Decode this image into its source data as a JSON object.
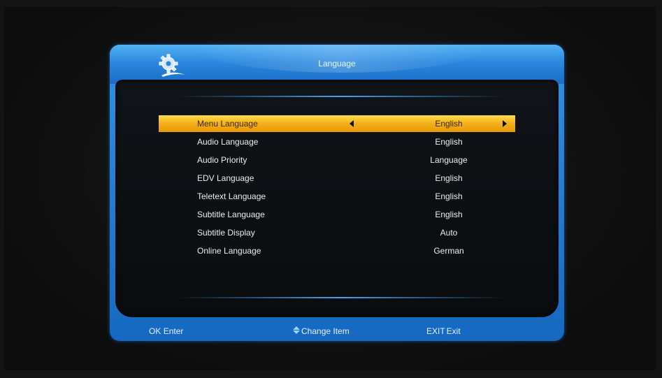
{
  "window": {
    "title": "Language"
  },
  "menu": {
    "items": [
      {
        "label": "Menu Language",
        "value": "English",
        "selected": true
      },
      {
        "label": "Audio Language",
        "value": "English"
      },
      {
        "label": "Audio Priority",
        "value": "Language"
      },
      {
        "label": "EDV Language",
        "value": "English"
      },
      {
        "label": "Teletext Language",
        "value": "English"
      },
      {
        "label": "Subtitle Language",
        "value": "English"
      },
      {
        "label": "Subtitle Display",
        "value": "Auto"
      },
      {
        "label": "Online Language",
        "value": "German"
      }
    ]
  },
  "footer": {
    "ok_key": "OK",
    "ok_label": "Enter",
    "change_label": "Change Item",
    "exit_key": "EXIT",
    "exit_label": "Exit"
  },
  "icons": {
    "logo": "gear-wrench-icon",
    "left_arrow": "triangle-left-icon",
    "right_arrow": "triangle-right-icon",
    "updown": "up-down-arrows-icon"
  },
  "colors": {
    "selection": "#f1ac16",
    "frame": "#1f78d0",
    "content_bg": "#0c0f12"
  }
}
